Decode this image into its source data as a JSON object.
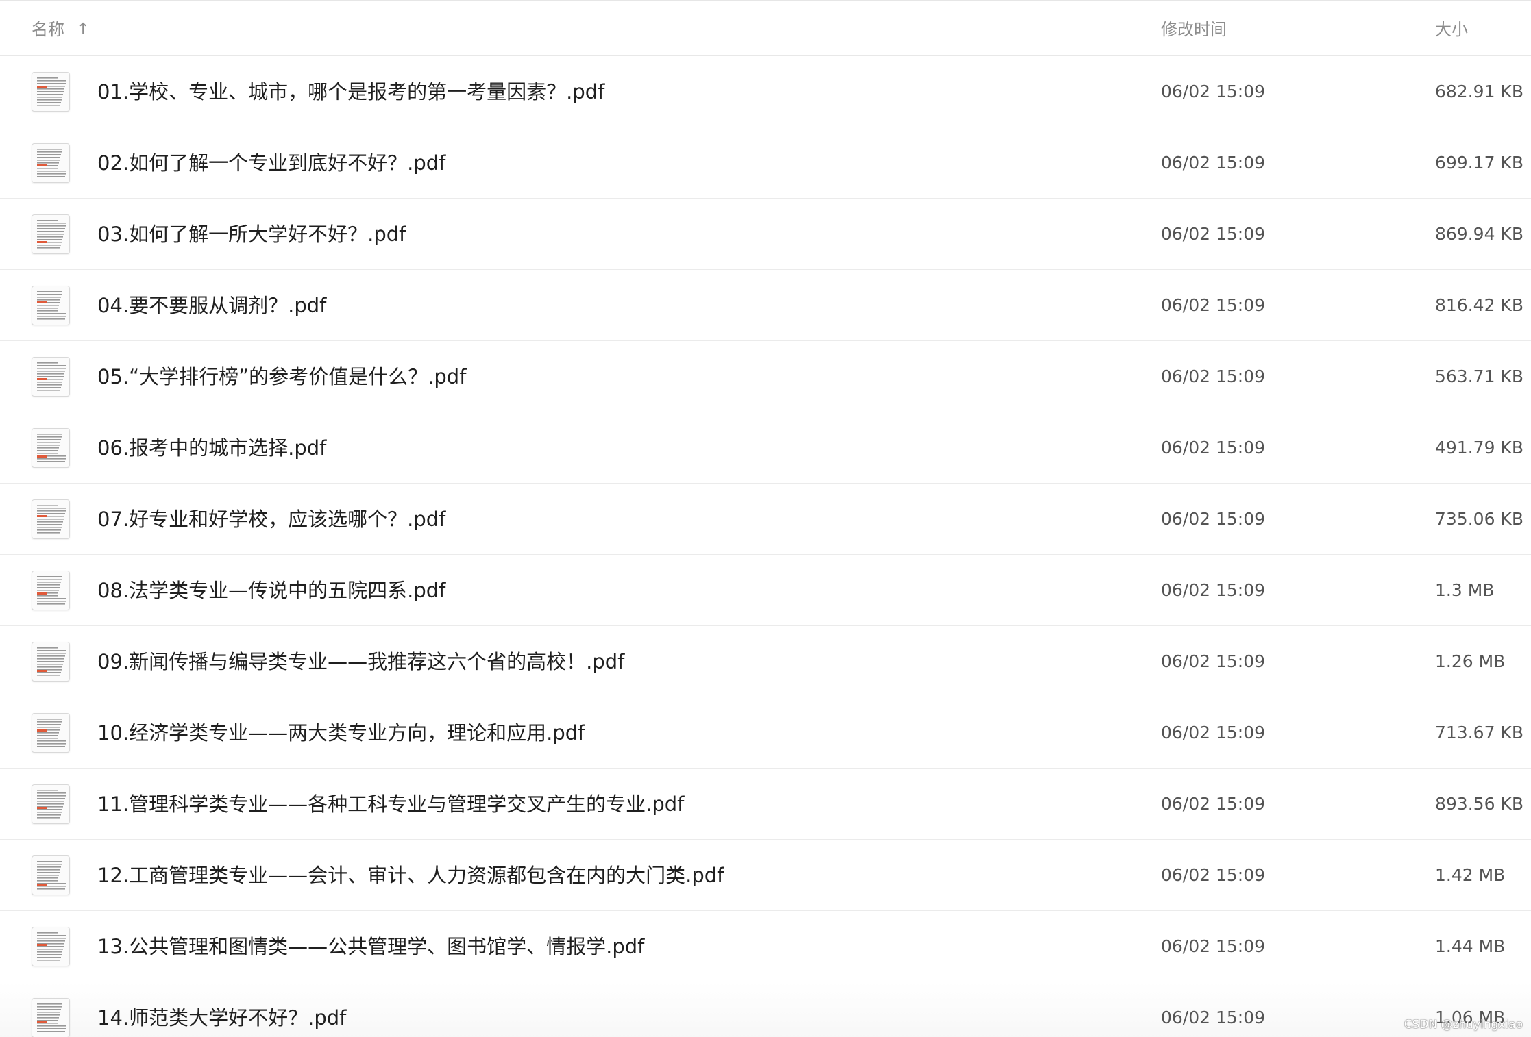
{
  "header": {
    "name_label": "名称",
    "sort_indicator": "↑",
    "time_label": "修改时间",
    "size_label": "大小"
  },
  "files": [
    {
      "name": "01.学校、专业、城市，哪个是报考的第一考量因素？.pdf",
      "modified": "06/02 15:09",
      "size": "682.91 KB",
      "icon": "pdf-thumbnail-icon"
    },
    {
      "name": "02.如何了解一个专业到底好不好？.pdf",
      "modified": "06/02 15:09",
      "size": "699.17 KB",
      "icon": "pdf-thumbnail-icon"
    },
    {
      "name": "03.如何了解一所大学好不好？.pdf",
      "modified": "06/02 15:09",
      "size": "869.94 KB",
      "icon": "pdf-thumbnail-icon"
    },
    {
      "name": "04.要不要服从调剂？.pdf",
      "modified": "06/02 15:09",
      "size": "816.42 KB",
      "icon": "pdf-thumbnail-icon"
    },
    {
      "name": "05.“大学排行榜”的参考价值是什么？.pdf",
      "modified": "06/02 15:09",
      "size": "563.71 KB",
      "icon": "pdf-thumbnail-icon"
    },
    {
      "name": "06.报考中的城市选择.pdf",
      "modified": "06/02 15:09",
      "size": "491.79 KB",
      "icon": "pdf-thumbnail-icon"
    },
    {
      "name": "07.好专业和好学校，应该选哪个？.pdf",
      "modified": "06/02 15:09",
      "size": "735.06 KB",
      "icon": "pdf-thumbnail-icon"
    },
    {
      "name": "08.法学类专业—传说中的五院四系.pdf",
      "modified": "06/02 15:09",
      "size": "1.3 MB",
      "icon": "pdf-thumbnail-icon"
    },
    {
      "name": "09.新闻传播与编导类专业——我推荐这六个省的高校！.pdf",
      "modified": "06/02 15:09",
      "size": "1.26 MB",
      "icon": "pdf-thumbnail-icon"
    },
    {
      "name": "10.经济学类专业——两大类专业方向，理论和应用.pdf",
      "modified": "06/02 15:09",
      "size": "713.67 KB",
      "icon": "pdf-thumbnail-icon"
    },
    {
      "name": "11.管理科学类专业——各种工科专业与管理学交叉产生的专业.pdf",
      "modified": "06/02 15:09",
      "size": "893.56 KB",
      "icon": "pdf-thumbnail-icon"
    },
    {
      "name": "12.工商管理类专业——会计、审计、人力资源都包含在内的大门类.pdf",
      "modified": "06/02 15:09",
      "size": "1.42 MB",
      "icon": "pdf-thumbnail-icon"
    },
    {
      "name": "13.公共管理和图情类——公共管理学、图书馆学、情报学.pdf",
      "modified": "06/02 15:09",
      "size": "1.44 MB",
      "icon": "pdf-thumbnail-icon"
    },
    {
      "name": "14.师范类大学好不好？.pdf",
      "modified": "06/02 15:09",
      "size": "1.06 MB",
      "icon": "pdf-thumbnail-icon"
    }
  ],
  "watermark": "CSDN @zhuyingxiao",
  "colors": {
    "header_text": "#8c8c8c",
    "row_text": "#1f1f1f",
    "meta_text": "#545454",
    "divider": "#ebebeb",
    "thumb_accent": "#e05a3a"
  }
}
